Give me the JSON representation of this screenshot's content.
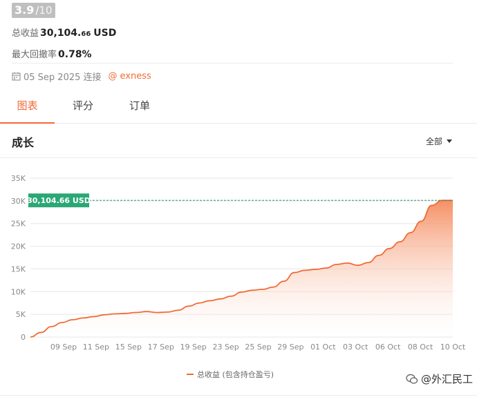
{
  "rating": {
    "value": "3.9",
    "separator": "/",
    "max": "10"
  },
  "stats": {
    "total_profit_label": "总收益",
    "total_profit_main": "30,104.",
    "total_profit_decimals": "66",
    "total_profit_unit": "USD",
    "max_drawdown_label": "最大回撤率",
    "max_drawdown_value": "0.78%"
  },
  "connection": {
    "calendar_icon": "calendar-icon",
    "date_text": "05 Sep 2025 连接",
    "broker_at": "@",
    "broker_name": "exness"
  },
  "tabs": [
    {
      "label": "图表",
      "active": true
    },
    {
      "label": "评分",
      "active": false
    },
    {
      "label": "订单",
      "active": false
    }
  ],
  "section": {
    "title": "成长",
    "range_label": "全部"
  },
  "colors": {
    "accent": "#f06a35",
    "badge_green": "#2aa775",
    "rating_bg": "#bfbfbf"
  },
  "chart_data": {
    "type": "area",
    "y_ticks": [
      "0",
      "5K",
      "10K",
      "15K",
      "20K",
      "25K",
      "30K",
      "35K"
    ],
    "ylim": [
      0,
      35000
    ],
    "x_tick_labels": [
      "09 Sep",
      "11 Sep",
      "15 Sep",
      "17 Sep",
      "19 Sep",
      "23 Sep",
      "25 Sep",
      "29 Sep",
      "01 Oct",
      "03 Oct",
      "06 Oct",
      "08 Oct",
      "10 Oct"
    ],
    "grid": true,
    "current_value_label": "30,104.66 USD",
    "current_value": 30104.66,
    "series": [
      {
        "name": "总收益 (包含持仓盈亏)",
        "values": [
          0,
          1000,
          2300,
          3200,
          3800,
          4200,
          4500,
          4900,
          5100,
          5200,
          5400,
          5600,
          5400,
          5500,
          5900,
          6800,
          7500,
          8000,
          8400,
          9000,
          9900,
          10300,
          10500,
          11000,
          12300,
          14200,
          14700,
          14900,
          15200,
          16000,
          16300,
          15800,
          16400,
          18000,
          19500,
          21000,
          23000,
          25500,
          29000,
          30104.66,
          30104.66
        ]
      }
    ]
  },
  "watermark": {
    "text": "@外汇民工"
  }
}
